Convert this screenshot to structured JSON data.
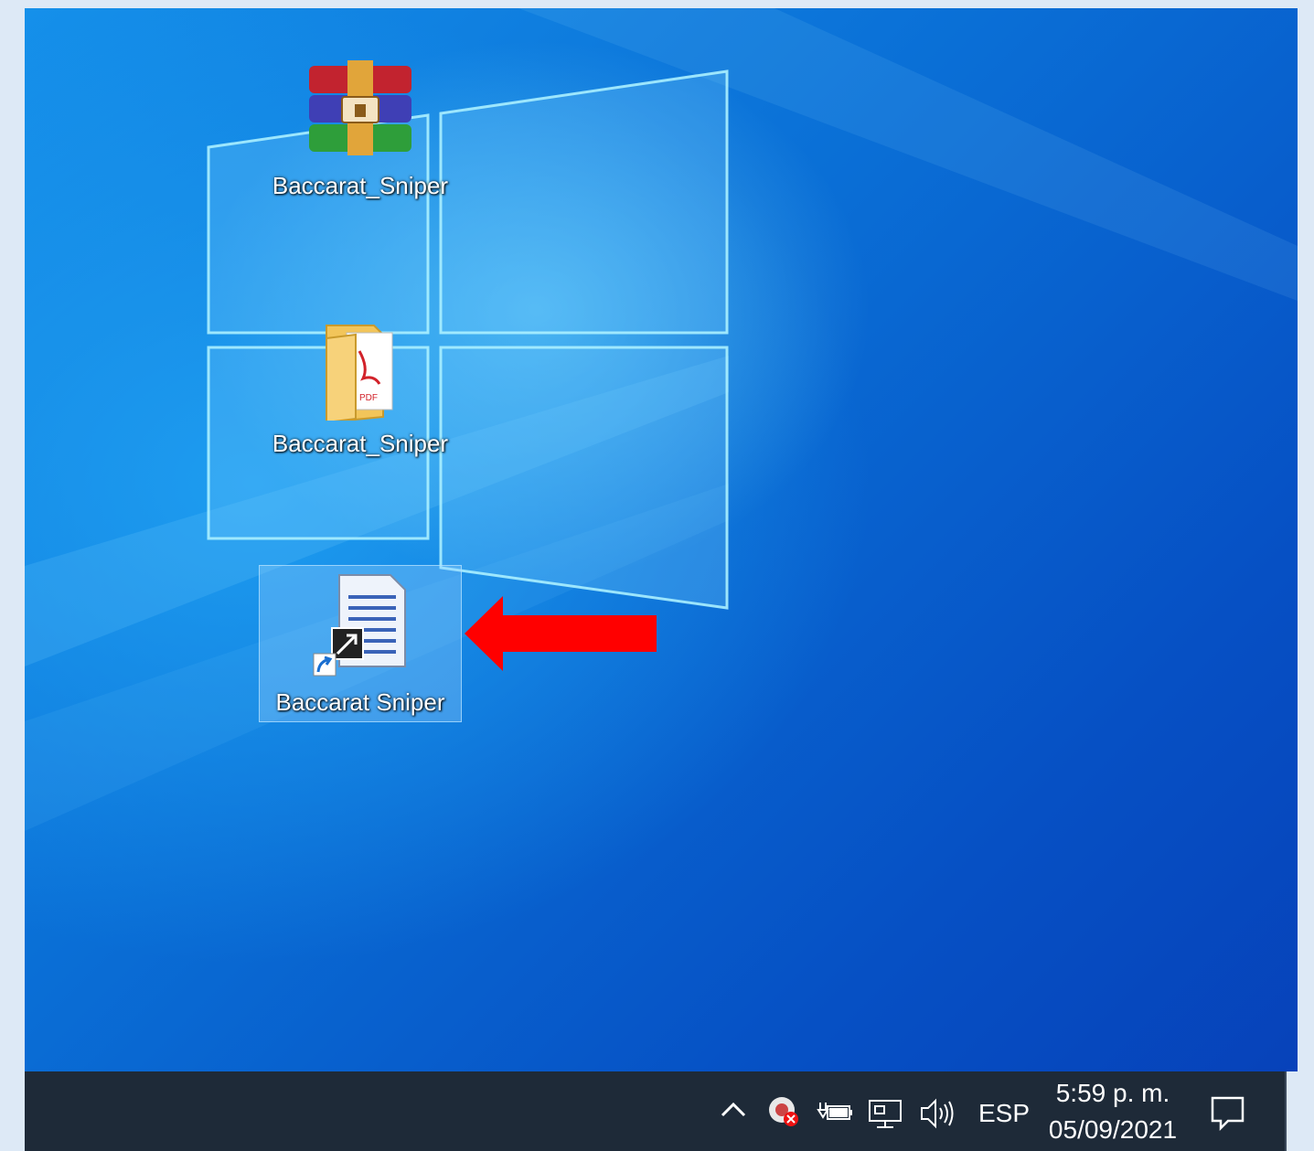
{
  "desktop": {
    "icons": [
      {
        "label": "Baccarat_Sniper",
        "icon": "winrar-archive-icon",
        "selected": false
      },
      {
        "label": "Baccarat_Sniper",
        "icon": "pdf-folder-icon",
        "selected": false
      },
      {
        "label": "Baccarat Sniper",
        "icon": "document-shortcut-icon",
        "selected": true
      }
    ],
    "annotation": {
      "icon": "red-arrow-icon",
      "color": "#ff0000"
    }
  },
  "taskbar": {
    "tray": {
      "chevron": "chevron-up-icon",
      "icons": [
        "antivirus-alert-icon",
        "power-battery-icon",
        "network-icon",
        "volume-icon"
      ],
      "language": "ESP"
    },
    "clock": {
      "time": "5:59 p. m.",
      "date": "05/09/2021"
    },
    "notifications": "action-center-icon"
  },
  "colors": {
    "taskbar": "#1e2a38",
    "accent": "#0a6fd6",
    "arrow": "#ff0000"
  }
}
